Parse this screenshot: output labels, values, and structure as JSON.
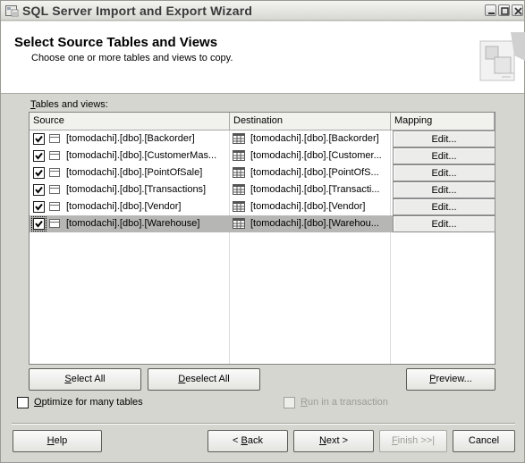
{
  "window": {
    "title": "SQL Server Import and Export Wizard"
  },
  "header": {
    "title": "Select Source Tables and Views",
    "subtitle": "Choose one or more tables and views to copy."
  },
  "list": {
    "label_underlined": "T",
    "label_rest": "ables and views:",
    "columns": {
      "source": "Source",
      "destination": "Destination",
      "mapping": "Mapping"
    },
    "rows": [
      {
        "checked": true,
        "source": "[tomodachi].[dbo].[Backorder]",
        "destination": "[tomodachi].[dbo].[Backorder]",
        "mapping": "Edit...",
        "selected": false
      },
      {
        "checked": true,
        "source": "[tomodachi].[dbo].[CustomerMas...",
        "destination": "[tomodachi].[dbo].[Customer...",
        "mapping": "Edit...",
        "selected": false
      },
      {
        "checked": true,
        "source": "[tomodachi].[dbo].[PointOfSale]",
        "destination": "[tomodachi].[dbo].[PointOfS...",
        "mapping": "Edit...",
        "selected": false
      },
      {
        "checked": true,
        "source": "[tomodachi].[dbo].[Transactions]",
        "destination": "[tomodachi].[dbo].[Transacti...",
        "mapping": "Edit...",
        "selected": false
      },
      {
        "checked": true,
        "source": "[tomodachi].[dbo].[Vendor]",
        "destination": "[tomodachi].[dbo].[Vendor]",
        "mapping": "Edit...",
        "selected": false
      },
      {
        "checked": true,
        "source": "[tomodachi].[dbo].[Warehouse]",
        "destination": "[tomodachi].[dbo].[Warehou...",
        "mapping": "Edit...",
        "selected": true
      }
    ]
  },
  "buttons": {
    "select_all_u": "S",
    "select_all_rest": "elect All",
    "deselect_all_u": "D",
    "deselect_all_rest": "eselect All",
    "preview_u": "P",
    "preview_rest": "review...",
    "help_u": "H",
    "help_rest": "elp",
    "back_pre": "< ",
    "back_u": "B",
    "back_rest": "ack",
    "next_u": "N",
    "next_rest": "ext >",
    "finish_u": "F",
    "finish_rest": "inish >>|",
    "cancel": "Cancel"
  },
  "options": {
    "optimize_u": "O",
    "optimize_rest": "ptimize for many tables",
    "optimize_checked": false,
    "transaction_u": "R",
    "transaction_rest": "un in a transaction",
    "transaction_checked": false
  },
  "icons": {
    "app": "wizard-app-icon",
    "minimize": "minimize-icon",
    "maximize": "maximize-icon",
    "close": "close-icon",
    "table": "table-icon",
    "destination_table": "grid-table-icon",
    "header_graphic": "tables-graphic-icon"
  }
}
